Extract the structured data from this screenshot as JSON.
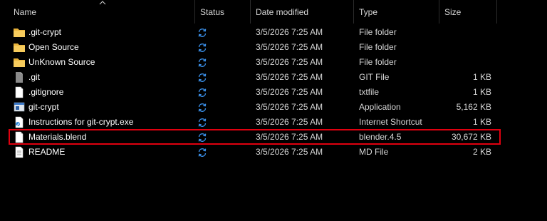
{
  "columns": {
    "name": "Name",
    "status": "Status",
    "date_modified": "Date modified",
    "type": "Type",
    "size": "Size"
  },
  "rows": [
    {
      "name": ".git-crypt",
      "icon": "folder-icon",
      "date": "3/5/2026 7:25 AM",
      "type": "File folder",
      "size": ""
    },
    {
      "name": "Open Source",
      "icon": "folder-icon",
      "date": "3/5/2026 7:25 AM",
      "type": "File folder",
      "size": ""
    },
    {
      "name": "UnKnown Source",
      "icon": "folder-icon",
      "date": "3/5/2026 7:25 AM",
      "type": "File folder",
      "size": ""
    },
    {
      "name": ".git",
      "icon": "gray-file-icon",
      "date": "3/5/2026 7:25 AM",
      "type": "GIT File",
      "size": "1 KB"
    },
    {
      "name": ".gitignore",
      "icon": "white-file-icon",
      "date": "3/5/2026 7:25 AM",
      "type": "txtfile",
      "size": "1 KB"
    },
    {
      "name": "git-crypt",
      "icon": "application-icon",
      "date": "3/5/2026 7:25 AM",
      "type": "Application",
      "size": "5,162 KB"
    },
    {
      "name": "Instructions for git-crypt.exe",
      "icon": "shortcut-icon",
      "date": "3/5/2026 7:25 AM",
      "type": "Internet Shortcut",
      "size": "1 KB"
    },
    {
      "name": "Materials.blend",
      "icon": "white-file-icon",
      "date": "3/5/2026 7:25 AM",
      "type": "blender.4.5",
      "size": "30,672 KB"
    },
    {
      "name": "README",
      "icon": "text-file-icon",
      "date": "3/5/2026 7:25 AM",
      "type": "MD File",
      "size": "2 KB"
    }
  ],
  "status_icon": "sync-icon",
  "colors": {
    "background": "#000000",
    "folder": "#f2c14e",
    "sync": "#3a8ee6",
    "highlight": "#e0000f"
  }
}
